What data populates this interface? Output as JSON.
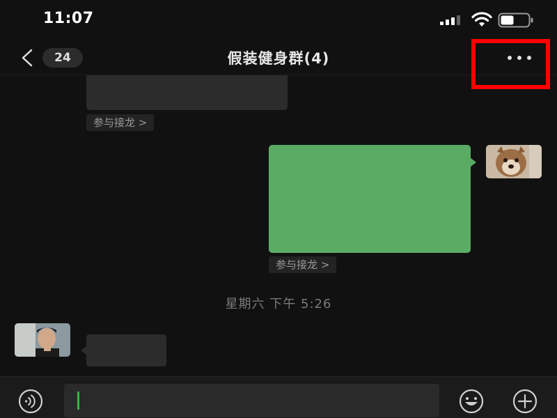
{
  "status_bar": {
    "time": "11:07",
    "icons": [
      "signal-icon",
      "wifi-icon",
      "battery-icon"
    ]
  },
  "header": {
    "back_icon": "chevron-left-icon",
    "unread_count": "24",
    "title": "假装健身群(4)",
    "more_icon": "more-dots-icon"
  },
  "messages": [
    {
      "side": "left",
      "type": "text",
      "relay_label": "参与接龙 >"
    },
    {
      "side": "right",
      "type": "text",
      "relay_label": "参与接龙 >"
    },
    {
      "type": "timestamp",
      "text": "星期六 下午 5:26"
    },
    {
      "side": "left",
      "type": "text"
    }
  ],
  "input_bar": {
    "voice_icon": "voice-icon",
    "emoji_icon": "smiley-icon",
    "plus_icon": "plus-icon",
    "value": ""
  },
  "colors": {
    "background": "#111111",
    "outgoing_bubble": "#5aac65",
    "incoming_bubble": "#2c2c2c",
    "highlight": "#ff0000",
    "caret": "#3cb04a"
  }
}
